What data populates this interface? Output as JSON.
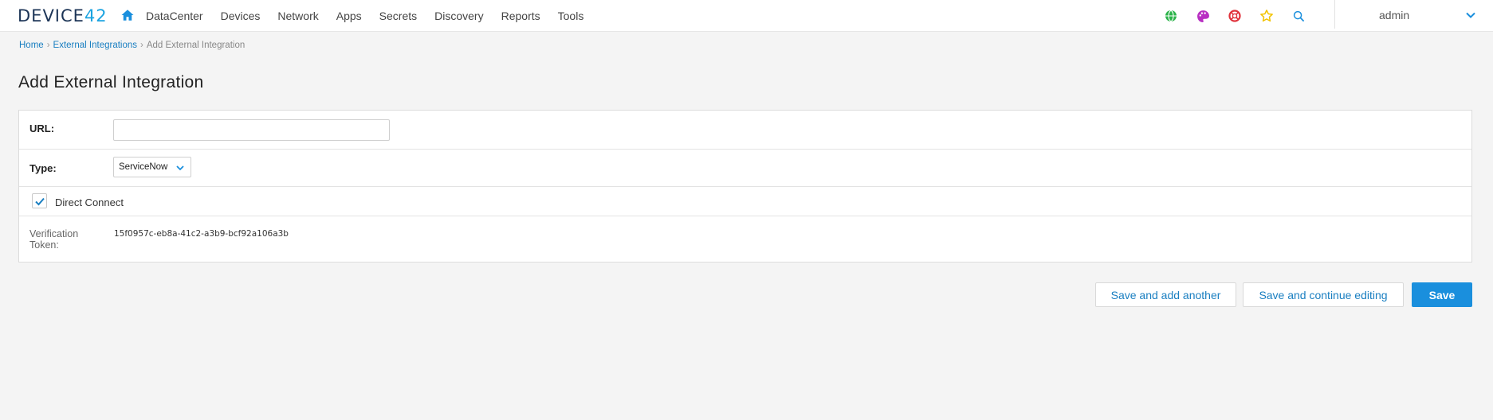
{
  "brand": {
    "logo_text": "DEVICE",
    "logo_num": "42"
  },
  "nav": {
    "menu": [
      "DataCenter",
      "Devices",
      "Network",
      "Apps",
      "Secrets",
      "Discovery",
      "Reports",
      "Tools"
    ],
    "icons": [
      "globe-icon",
      "palette-icon",
      "lifebuoy-icon",
      "star-icon",
      "search-icon"
    ],
    "user": "admin"
  },
  "breadcrumb": {
    "home": "Home",
    "parent": "External Integrations",
    "current": "Add External Integration",
    "separator": "›"
  },
  "page": {
    "title": "Add External Integration"
  },
  "form": {
    "url_label": "URL:",
    "url_value": "",
    "type_label": "Type:",
    "type_selected": "ServiceNow",
    "direct_connect_label": "Direct Connect",
    "direct_connect_checked": true,
    "token_label_line1": "Verification",
    "token_label_line2": "Token:",
    "token_value": "15f0957c-eb8a-41c2-a3b9-bcf92a106a3b"
  },
  "buttons": {
    "save_add": "Save and add another",
    "save_continue": "Save and continue editing",
    "save": "Save"
  },
  "colors": {
    "accent": "#1a8fdd",
    "link": "#1a7fc1",
    "brand_dark": "#1d3557"
  }
}
